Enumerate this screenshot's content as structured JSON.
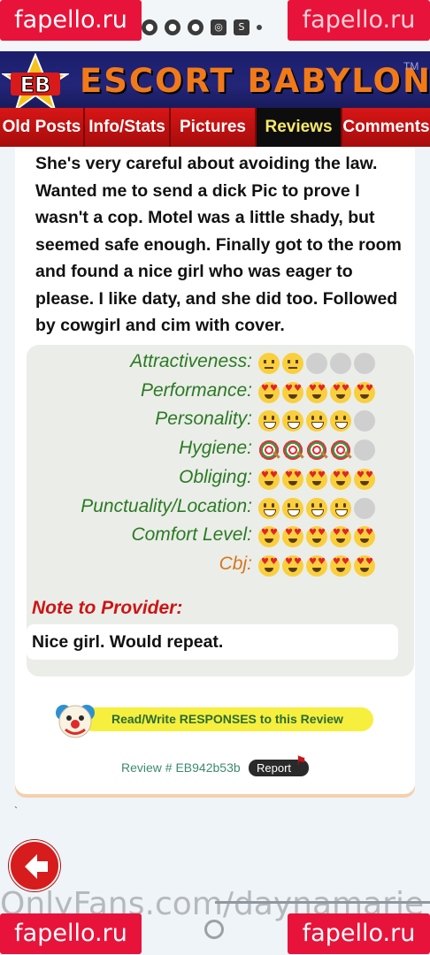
{
  "watermarks": {
    "top_left": "fapello.ru",
    "top_right": "fapello.ru",
    "bottom_left": "fapello.ru",
    "bottom_right": "fapello.ru",
    "onlyfans": "OnlyFans.com/daynamarie"
  },
  "header": {
    "logo_text": "EB",
    "brand": "ESCORT BABYLON",
    "trademark": "TM"
  },
  "nav": {
    "tabs": [
      {
        "label": "Old Posts",
        "active": false
      },
      {
        "label": "Info/Stats",
        "active": false
      },
      {
        "label": "Pictures",
        "active": false
      },
      {
        "label": "Reviews",
        "active": true
      },
      {
        "label": "Comments",
        "active": false
      }
    ]
  },
  "review": {
    "text": "She's very careful about avoiding the law. Wanted me to send a dick Pic to prove I wasn't a cop. Motel was a little shady, but seemed safe enough. Finally got to the room and found a nice girl who was eager to please. I like daty, and she did too. Followed by cowgirl and cim with cover."
  },
  "ratings": [
    {
      "label": "Attractiveness:",
      "icon": "neutral-face",
      "score": 2,
      "max": 5
    },
    {
      "label": "Performance:",
      "icon": "heart-eyes-face",
      "score": 5,
      "max": 5
    },
    {
      "label": "Personality:",
      "icon": "smile-face",
      "score": 4,
      "max": 5
    },
    {
      "label": "Hygiene:",
      "icon": "lollipop",
      "score": 4,
      "max": 5
    },
    {
      "label": "Obliging:",
      "icon": "heart-eyes-face",
      "score": 5,
      "max": 5
    },
    {
      "label": "Punctuality/Location:",
      "icon": "smile-face",
      "score": 4,
      "max": 5
    },
    {
      "label": "Comfort Level:",
      "icon": "heart-eyes-face",
      "score": 5,
      "max": 5
    },
    {
      "label": "Cbj:",
      "icon": "heart-eyes-face",
      "score": 5,
      "max": 5
    }
  ],
  "note": {
    "label": "Note to Provider:",
    "text": "Nice girl. Would repeat."
  },
  "responses_button": "Read/Write RESPONSES to this Review",
  "review_number": "Review # EB942b53b",
  "report_button": "Report",
  "backtick": "`",
  "colors": {
    "nav_red": "#bf0f0f",
    "active_tab": "#0d0d0d",
    "rating_green": "#2a7a22",
    "cbj_orange": "#d6761d",
    "note_red": "#cc1515",
    "watermark_red": "#e8133a"
  }
}
